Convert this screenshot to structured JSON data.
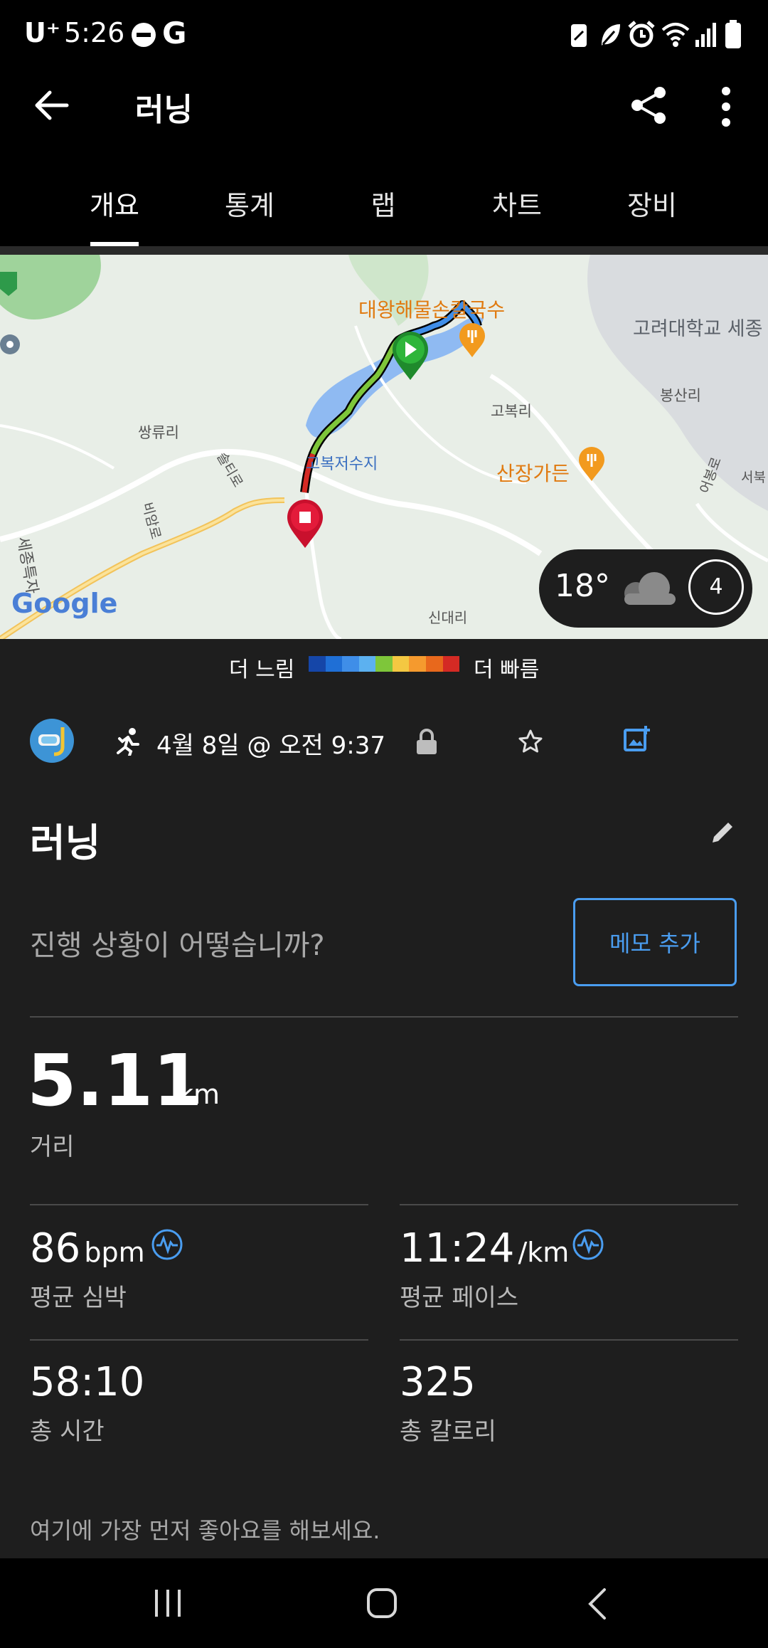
{
  "status_bar": {
    "carrier": "U⁺",
    "time": "5:26",
    "left_icons": [
      "do-not-disturb-icon",
      "google-icon"
    ],
    "right_icons": [
      "battery-saver-icon",
      "leaf-icon",
      "alarm-icon",
      "wifi-icon",
      "signal-icon",
      "battery-icon"
    ]
  },
  "header": {
    "title": "러닝",
    "back_icon": "back-arrow-icon",
    "share_icon": "share-icon",
    "more_icon": "more-vertical-icon"
  },
  "tabs": [
    {
      "label": "개요",
      "active": true
    },
    {
      "label": "통계",
      "active": false
    },
    {
      "label": "랩",
      "active": false
    },
    {
      "label": "차트",
      "active": false
    },
    {
      "label": "장비",
      "active": false
    }
  ],
  "map": {
    "labels": {
      "restaurant1": "대왕해물손칼국수",
      "university": "고려대학교 세종",
      "bongsan": "봉산리",
      "gobok": "고복리",
      "reservoir": "고복저수지",
      "sanjang": "산장가든",
      "ssangnyu": "쌍류리",
      "road1": "솔티로",
      "road2": "비암로",
      "road3": "세종특자",
      "road4": "어봉로",
      "seobuk": "서북",
      "sindae": "신대리",
      "google": "Google"
    },
    "weather": {
      "temp": "18°",
      "icon": "cloud-icon",
      "wind": "4"
    }
  },
  "legend": {
    "slow": "더 느림",
    "fast": "더 빠름",
    "colors": [
      "#1546a8",
      "#1f6fd6",
      "#3f8ee8",
      "#5cb1f0",
      "#7ec63a",
      "#f4c842",
      "#f59a2e",
      "#e8681c",
      "#d42a24"
    ]
  },
  "activity": {
    "meta": "4월 8일 @ 오전 9:37",
    "name": "러닝",
    "prompt": "진행 상황이 어떻습니까?",
    "memo_button": "메모 추가"
  },
  "stats": {
    "distance": {
      "value": "5.11",
      "unit": "km",
      "label": "거리"
    },
    "heart_rate": {
      "value": "86",
      "unit": "bpm",
      "label": "평균 심박"
    },
    "pace": {
      "value": "11:24",
      "unit": "/km",
      "label": "평균 페이스"
    },
    "time": {
      "value": "58:10",
      "label": "총 시간"
    },
    "calories": {
      "value": "325",
      "label": "총 칼로리"
    }
  },
  "likes_prompt": "여기에 가장 먼저 좋아요를 해보세요.",
  "accent_color": "#4a9df0"
}
